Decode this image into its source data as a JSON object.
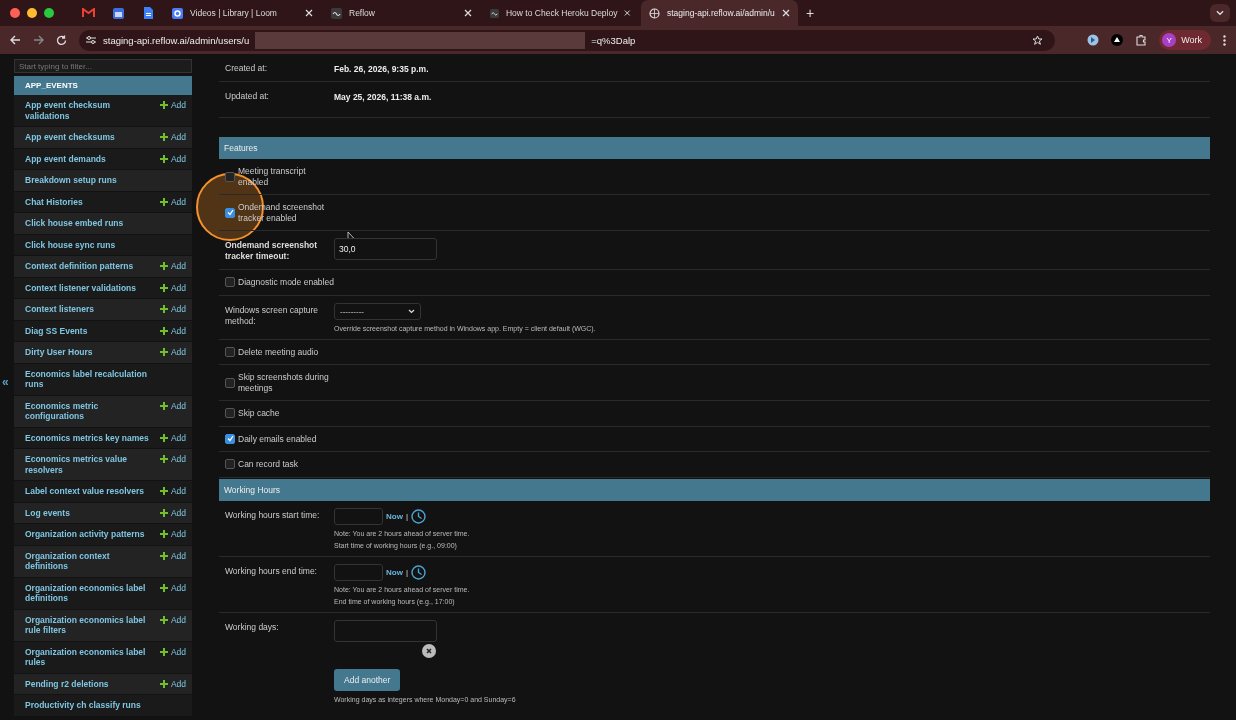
{
  "browser": {
    "tabs": [
      {
        "kind": "pinned",
        "selected": false
      },
      {
        "kind": "pinned",
        "selected": false
      },
      {
        "kind": "pinned",
        "selected": false
      },
      {
        "kind": "full",
        "title": "Videos | Library | Loom",
        "selected": false
      },
      {
        "kind": "full",
        "title": "Reflow",
        "selected": false
      },
      {
        "kind": "full",
        "title": "How to Check Heroku Deploy",
        "selected": false
      },
      {
        "kind": "full",
        "title": "staging-api.reflow.ai/admin/u",
        "selected": true
      }
    ],
    "new_tab": "+",
    "address_start": "staging-api.reflow.ai/admin/users/u",
    "address_end": "=q%3Dalp",
    "profile_initial": "Y",
    "profile_name": "Work"
  },
  "sidebar": {
    "filter_placeholder": "Start typing to filter...",
    "collapse": "«",
    "app": "APP_EVENTS",
    "items": [
      {
        "name": "App event checksum validations",
        "add": "Add"
      },
      {
        "name": "App event checksums",
        "add": "Add"
      },
      {
        "name": "App event demands",
        "add": "Add"
      },
      {
        "name": "Breakdown setup runs"
      },
      {
        "name": "Chat Histories",
        "add": "Add"
      },
      {
        "name": "Click house embed runs"
      },
      {
        "name": "Click house sync runs"
      },
      {
        "name": "Context definition patterns",
        "add": "Add"
      },
      {
        "name": "Context listener validations",
        "add": "Add"
      },
      {
        "name": "Context listeners",
        "add": "Add"
      },
      {
        "name": "Diag SS Events",
        "add": "Add"
      },
      {
        "name": "Dirty User Hours",
        "add": "Add"
      },
      {
        "name": "Economics label recalculation runs"
      },
      {
        "name": "Economics metric configurations",
        "add": "Add"
      },
      {
        "name": "Economics metrics key names",
        "add": "Add"
      },
      {
        "name": "Economics metrics value resolvers",
        "add": "Add"
      },
      {
        "name": "Label context value resolvers",
        "add": "Add"
      },
      {
        "name": "Log events",
        "add": "Add"
      },
      {
        "name": "Organization activity patterns",
        "add": "Add"
      },
      {
        "name": "Organization context definitions",
        "add": "Add"
      },
      {
        "name": "Organization economics label definitions",
        "add": "Add"
      },
      {
        "name": "Organization economics label rule filters",
        "add": "Add"
      },
      {
        "name": "Organization economics label rules",
        "add": "Add"
      },
      {
        "name": "Pending r2 deletions",
        "add": "Add"
      },
      {
        "name": "Productivity ch classify runs"
      }
    ]
  },
  "top_fields": [
    {
      "label": "Created at:",
      "value": "Feb. 26, 2026, 9:35 p.m."
    },
    {
      "label": "Updated at:",
      "value": "May 25, 2026, 11:38 a.m."
    }
  ],
  "sections": [
    {
      "title": "Features",
      "fields": [
        {
          "kind": "checkbox",
          "label": "Meeting transcript enabled",
          "checked": false
        },
        {
          "kind": "checkbox",
          "label": "Ondemand screenshot tracker enabled",
          "checked": true
        },
        {
          "kind": "text",
          "label": "Ondemand screenshot tracker timeout:",
          "value": "30,0"
        },
        {
          "kind": "checkbox",
          "label": "Diagnostic mode enabled",
          "checked": false
        },
        {
          "kind": "select",
          "label": "Windows screen capture method:",
          "value": "---------",
          "help": "Override screenshot capture method in Windows app. Empty = client default (WGC)."
        },
        {
          "kind": "checkbox",
          "label": "Delete meeting audio",
          "checked": false
        },
        {
          "kind": "checkbox",
          "label": "Skip screenshots during meetings",
          "checked": false
        },
        {
          "kind": "checkbox",
          "label": "Skip cache",
          "checked": false
        },
        {
          "kind": "checkbox",
          "label": "Daily emails enabled",
          "checked": true
        },
        {
          "kind": "checkbox",
          "label": "Can record task",
          "checked": false
        }
      ]
    },
    {
      "title": "Working Hours",
      "fields": [
        {
          "kind": "time",
          "label": "Working hours start time:",
          "now": "Now",
          "separator": "|",
          "note": "Note: You are 2 hours ahead of server time.",
          "help": "Start time of working hours (e.g., 09:00)"
        },
        {
          "kind": "time",
          "label": "Working hours end time:",
          "now": "Now",
          "separator": "|",
          "note": "Note: You are 2 hours ahead of server time.",
          "help": "End time of working hours (e.g., 17:00)"
        },
        {
          "kind": "array",
          "label": "Working days:",
          "button": "Add another",
          "help": "Working days as integers where Monday=0 and Sunday=6"
        }
      ]
    }
  ]
}
